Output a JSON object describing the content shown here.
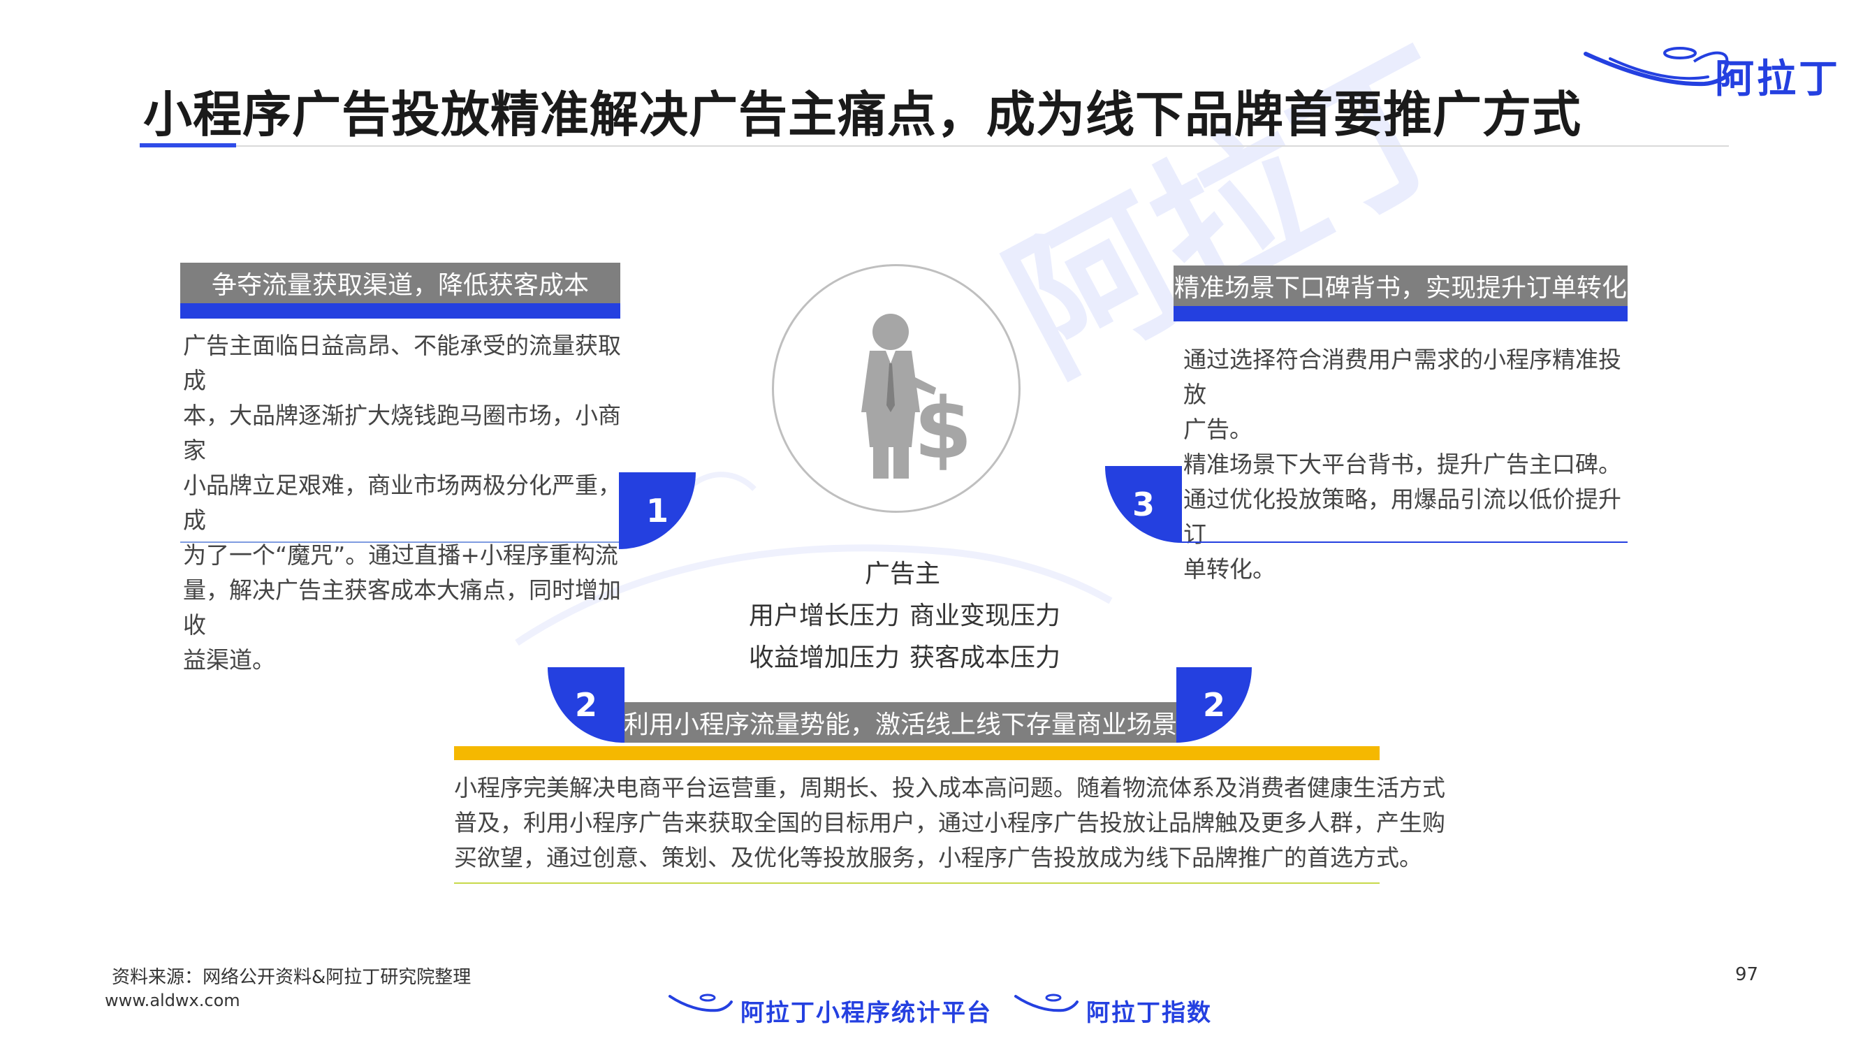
{
  "header": {
    "title": "小程序广告投放精准解决广告主痛点，成为线下品牌首要推广方式",
    "logo_text": "阿拉丁"
  },
  "watermark": {
    "text": "阿拉丁"
  },
  "panel1": {
    "number": "1",
    "title": "争夺流量获取渠道，降低获客成本",
    "lines": [
      "广告主面临日益高昂、不能承受的流量获取成",
      "本，大品牌逐渐扩大烧钱跑马圈市场，小商家",
      "小品牌立足艰难，商业市场两极分化严重，成",
      "为了一个“魔咒”。通过直播+小程序重构流",
      "量，解决广告主获客成本大痛点，同时增加收",
      "益渠道。"
    ]
  },
  "panel3": {
    "number": "3",
    "title": "精准场景下口碑背书，实现提升订单转化",
    "lines": [
      "通过选择符合消费用户需求的小程序精准投放",
      "广告。",
      "精准场景下大平台背书，提升广告主口碑。",
      "通过优化投放策略，用爆品引流以低价提升订",
      "单转化。"
    ]
  },
  "center": {
    "title": "广告主",
    "row1": [
      "用户增长压力",
      "商业变现压力"
    ],
    "row2": [
      "收益增加压力",
      "获客成本压力"
    ]
  },
  "panel2": {
    "number": "2",
    "title": "利用小程序流量势能，激活线上线下存量商业场景",
    "lines": [
      "小程序完美解决电商平台运营重，周期长、投入成本高问题。随着物流体系及消费者健康生活方式",
      "普及，利用小程序广告来获取全国的目标用户，通过小程序广告投放让品牌触及更多人群，产生购",
      "买欲望，通过创意、策划、及优化等投放服务，小程序广告投放成为线下品牌推广的首选方式。"
    ]
  },
  "footer": {
    "source": "资料来源：网络公开资料&阿拉丁研究院整理",
    "url": "www.aldwx.com",
    "page": "97",
    "brand1": "阿拉丁小程序统计平台",
    "brand2": "阿拉丁指数"
  },
  "colors": {
    "accent_blue": "#2440e0",
    "gray_header": "#7f7f7f",
    "yellow": "#f5b800"
  }
}
